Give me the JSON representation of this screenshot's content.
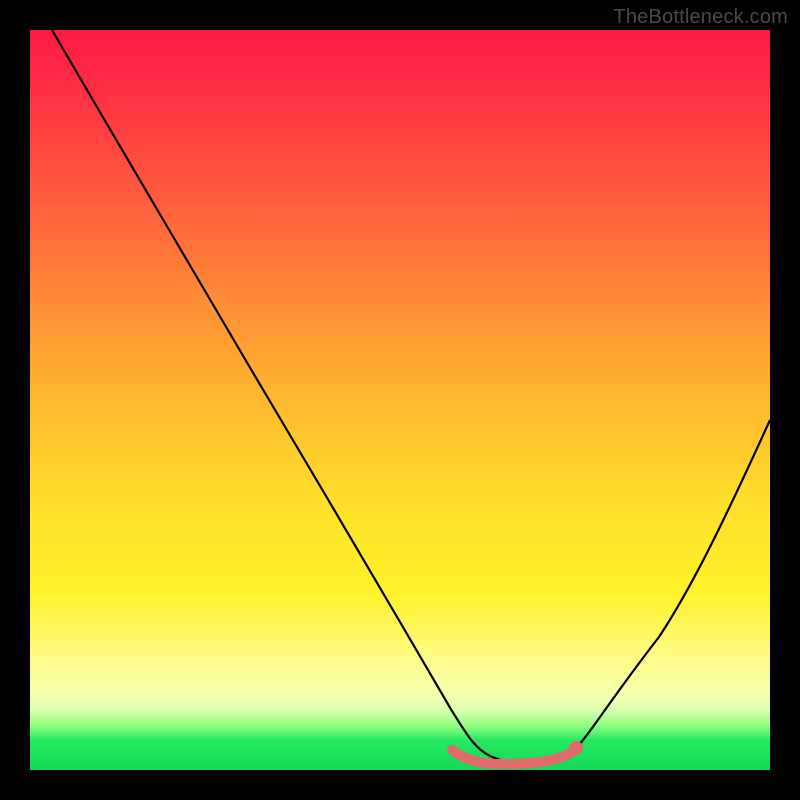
{
  "watermark": "TheBottleneck.com",
  "colors": {
    "background": "#000000",
    "gradient_top": "#ff1a44",
    "gradient_mid": "#ffdf2a",
    "gradient_bottom": "#14d957",
    "curve": "#000000",
    "marker": "#e26a6a"
  },
  "chart_data": {
    "type": "line",
    "title": "",
    "xlabel": "",
    "ylabel": "",
    "xlim": [
      0,
      100
    ],
    "ylim": [
      0,
      100
    ],
    "series": [
      {
        "name": "bottleneck-curve",
        "x": [
          3,
          10,
          20,
          30,
          40,
          50,
          57,
          60,
          65,
          70,
          73,
          78,
          85,
          92,
          100
        ],
        "y": [
          100,
          88,
          71,
          54,
          37,
          20,
          8,
          4,
          1,
          1,
          2,
          6,
          18,
          33,
          53
        ]
      }
    ],
    "annotations": [
      {
        "name": "flat-minimum-band",
        "x_start": 57,
        "x_end": 73,
        "y": 2
      },
      {
        "name": "marker-dot",
        "x": 73,
        "y": 2.5
      }
    ]
  }
}
